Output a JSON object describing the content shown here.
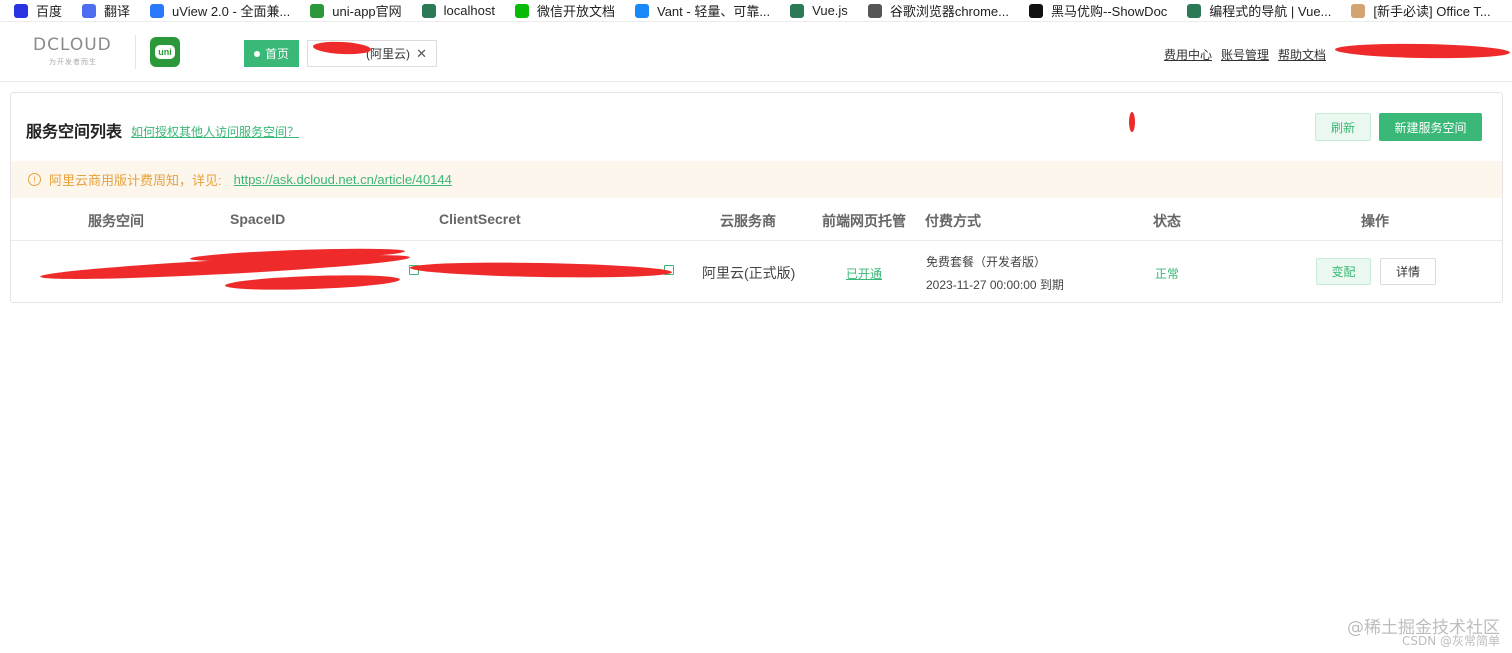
{
  "bookmarks": [
    {
      "label": "百度",
      "icon": "baidu-paw-icon",
      "color": "#2932e1"
    },
    {
      "label": "翻译",
      "icon": "translate-icon",
      "color": "#4e6ef2"
    },
    {
      "label": "uView 2.0 - 全面兼...",
      "icon": "uview-icon",
      "color": "#2979ff"
    },
    {
      "label": "uni-app官网",
      "icon": "uniapp-icon",
      "color": "#2b9939"
    },
    {
      "label": "localhost",
      "icon": "vue-icon",
      "color": "#2b7a55"
    },
    {
      "label": "微信开放文档",
      "icon": "wechat-icon",
      "color": "#09bb07"
    },
    {
      "label": "Vant - 轻量、可靠...",
      "icon": "vant-icon",
      "color": "#1989fa"
    },
    {
      "label": "Vue.js",
      "icon": "vue-icon",
      "color": "#2b7a55"
    },
    {
      "label": "谷歌浏览器chrome...",
      "icon": "chrome-icon",
      "color": "#555555"
    },
    {
      "label": "黑马优购--ShowDoc",
      "icon": "showdoc-icon",
      "color": "#111111"
    },
    {
      "label": "编程式的导航 | Vue...",
      "icon": "vue-icon",
      "color": "#2b7a55"
    },
    {
      "label": "[新手必读] Office T...",
      "icon": "office-icon",
      "color": "#d4a373"
    }
  ],
  "header": {
    "logo_main": "DCLOUD",
    "logo_sub": "为开发者而生",
    "uni_label": "uni",
    "tab_home": "首页",
    "tab_space": "(阿里云)",
    "links": [
      "费用中心",
      "账号管理",
      "帮助文档"
    ]
  },
  "card": {
    "title": "服务空间列表",
    "help_link": "如何授权其他人访问服务空间？",
    "refresh_btn": "刷新",
    "new_btn": "新建服务空间",
    "notice_text": "阿里云商用版计费周知，详见:",
    "notice_link": "https://ask.dcloud.net.cn/article/40144",
    "columns": [
      "服务空间",
      "SpaceID",
      "ClientSecret",
      "云服务商",
      "前端网页托管",
      "付费方式",
      "状态",
      "操作"
    ],
    "row": {
      "provider": "阿里云(正式版)",
      "hosting": "已开通",
      "plan": "免费套餐（开发者版）",
      "expiry": "2023-11-27 00:00:00 到期",
      "status": "正常",
      "change_btn": "变配",
      "detail_btn": "详情"
    }
  },
  "watermark": {
    "line1": "@稀土掘金技术社区",
    "line2": "CSDN @灰常简单"
  },
  "colors": {
    "accent": "#3ab877",
    "warning": "#e6a23c",
    "redaction": "#ee2a2a"
  }
}
